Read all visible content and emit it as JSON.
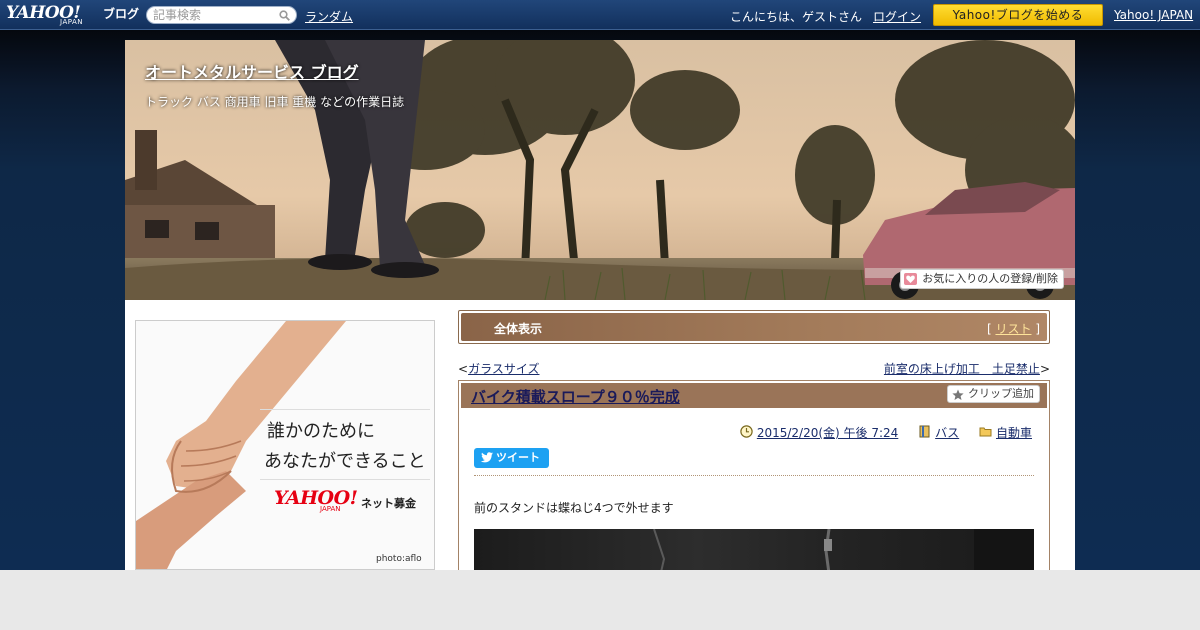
{
  "topbar": {
    "logo_main": "YAHOO!",
    "logo_sub": "JAPAN",
    "logo_service": "ブログ",
    "search_placeholder": "記事検索",
    "random_label": "ランダム",
    "greeting": "こんにちは、ゲストさん",
    "login_label": "ログイン",
    "start_blog_label": "Yahoo!ブログを始める",
    "yahoo_japan_label": "Yahoo! JAPAN"
  },
  "blog_header": {
    "title": "オートメタルサービス ブログ",
    "subtitle": "トラック バス 商用車 旧車 重機 などの作業日誌",
    "favorite_label": "お気に入りの人の登録/削除"
  },
  "ad": {
    "copy_line1": "誰かのために",
    "copy_line2": "あなたができること",
    "logo": "YAHOO!",
    "logo_sub": "JAPAN",
    "label": "ネット募金",
    "photo_credit": "photo:aflo"
  },
  "filter_bar": {
    "label": "全体表示",
    "list_prefix": "[",
    "list_label": "リスト",
    "list_suffix": "]"
  },
  "navigation": {
    "prev_prefix": "<",
    "prev_label": "ガラスサイズ",
    "next_label": "前室の床上げ加工　土足禁止",
    "next_suffix": ">"
  },
  "post": {
    "title": "バイク積載スロープ９０％完成",
    "clip_label": "クリップ追加",
    "datetime": "2015/2/20(金) 午後 7:24",
    "tag": "バス",
    "category": "自動車",
    "tweet_label": "ツイート",
    "body_text": "前のスタンドは蝶ねじ4つで外せます"
  },
  "colors": {
    "topbar": "#1a3c6e",
    "accent_yellow": "#f5c400",
    "post_header": "#9a7458",
    "link": "#1a2d6b",
    "twitter": "#1da1f2"
  }
}
